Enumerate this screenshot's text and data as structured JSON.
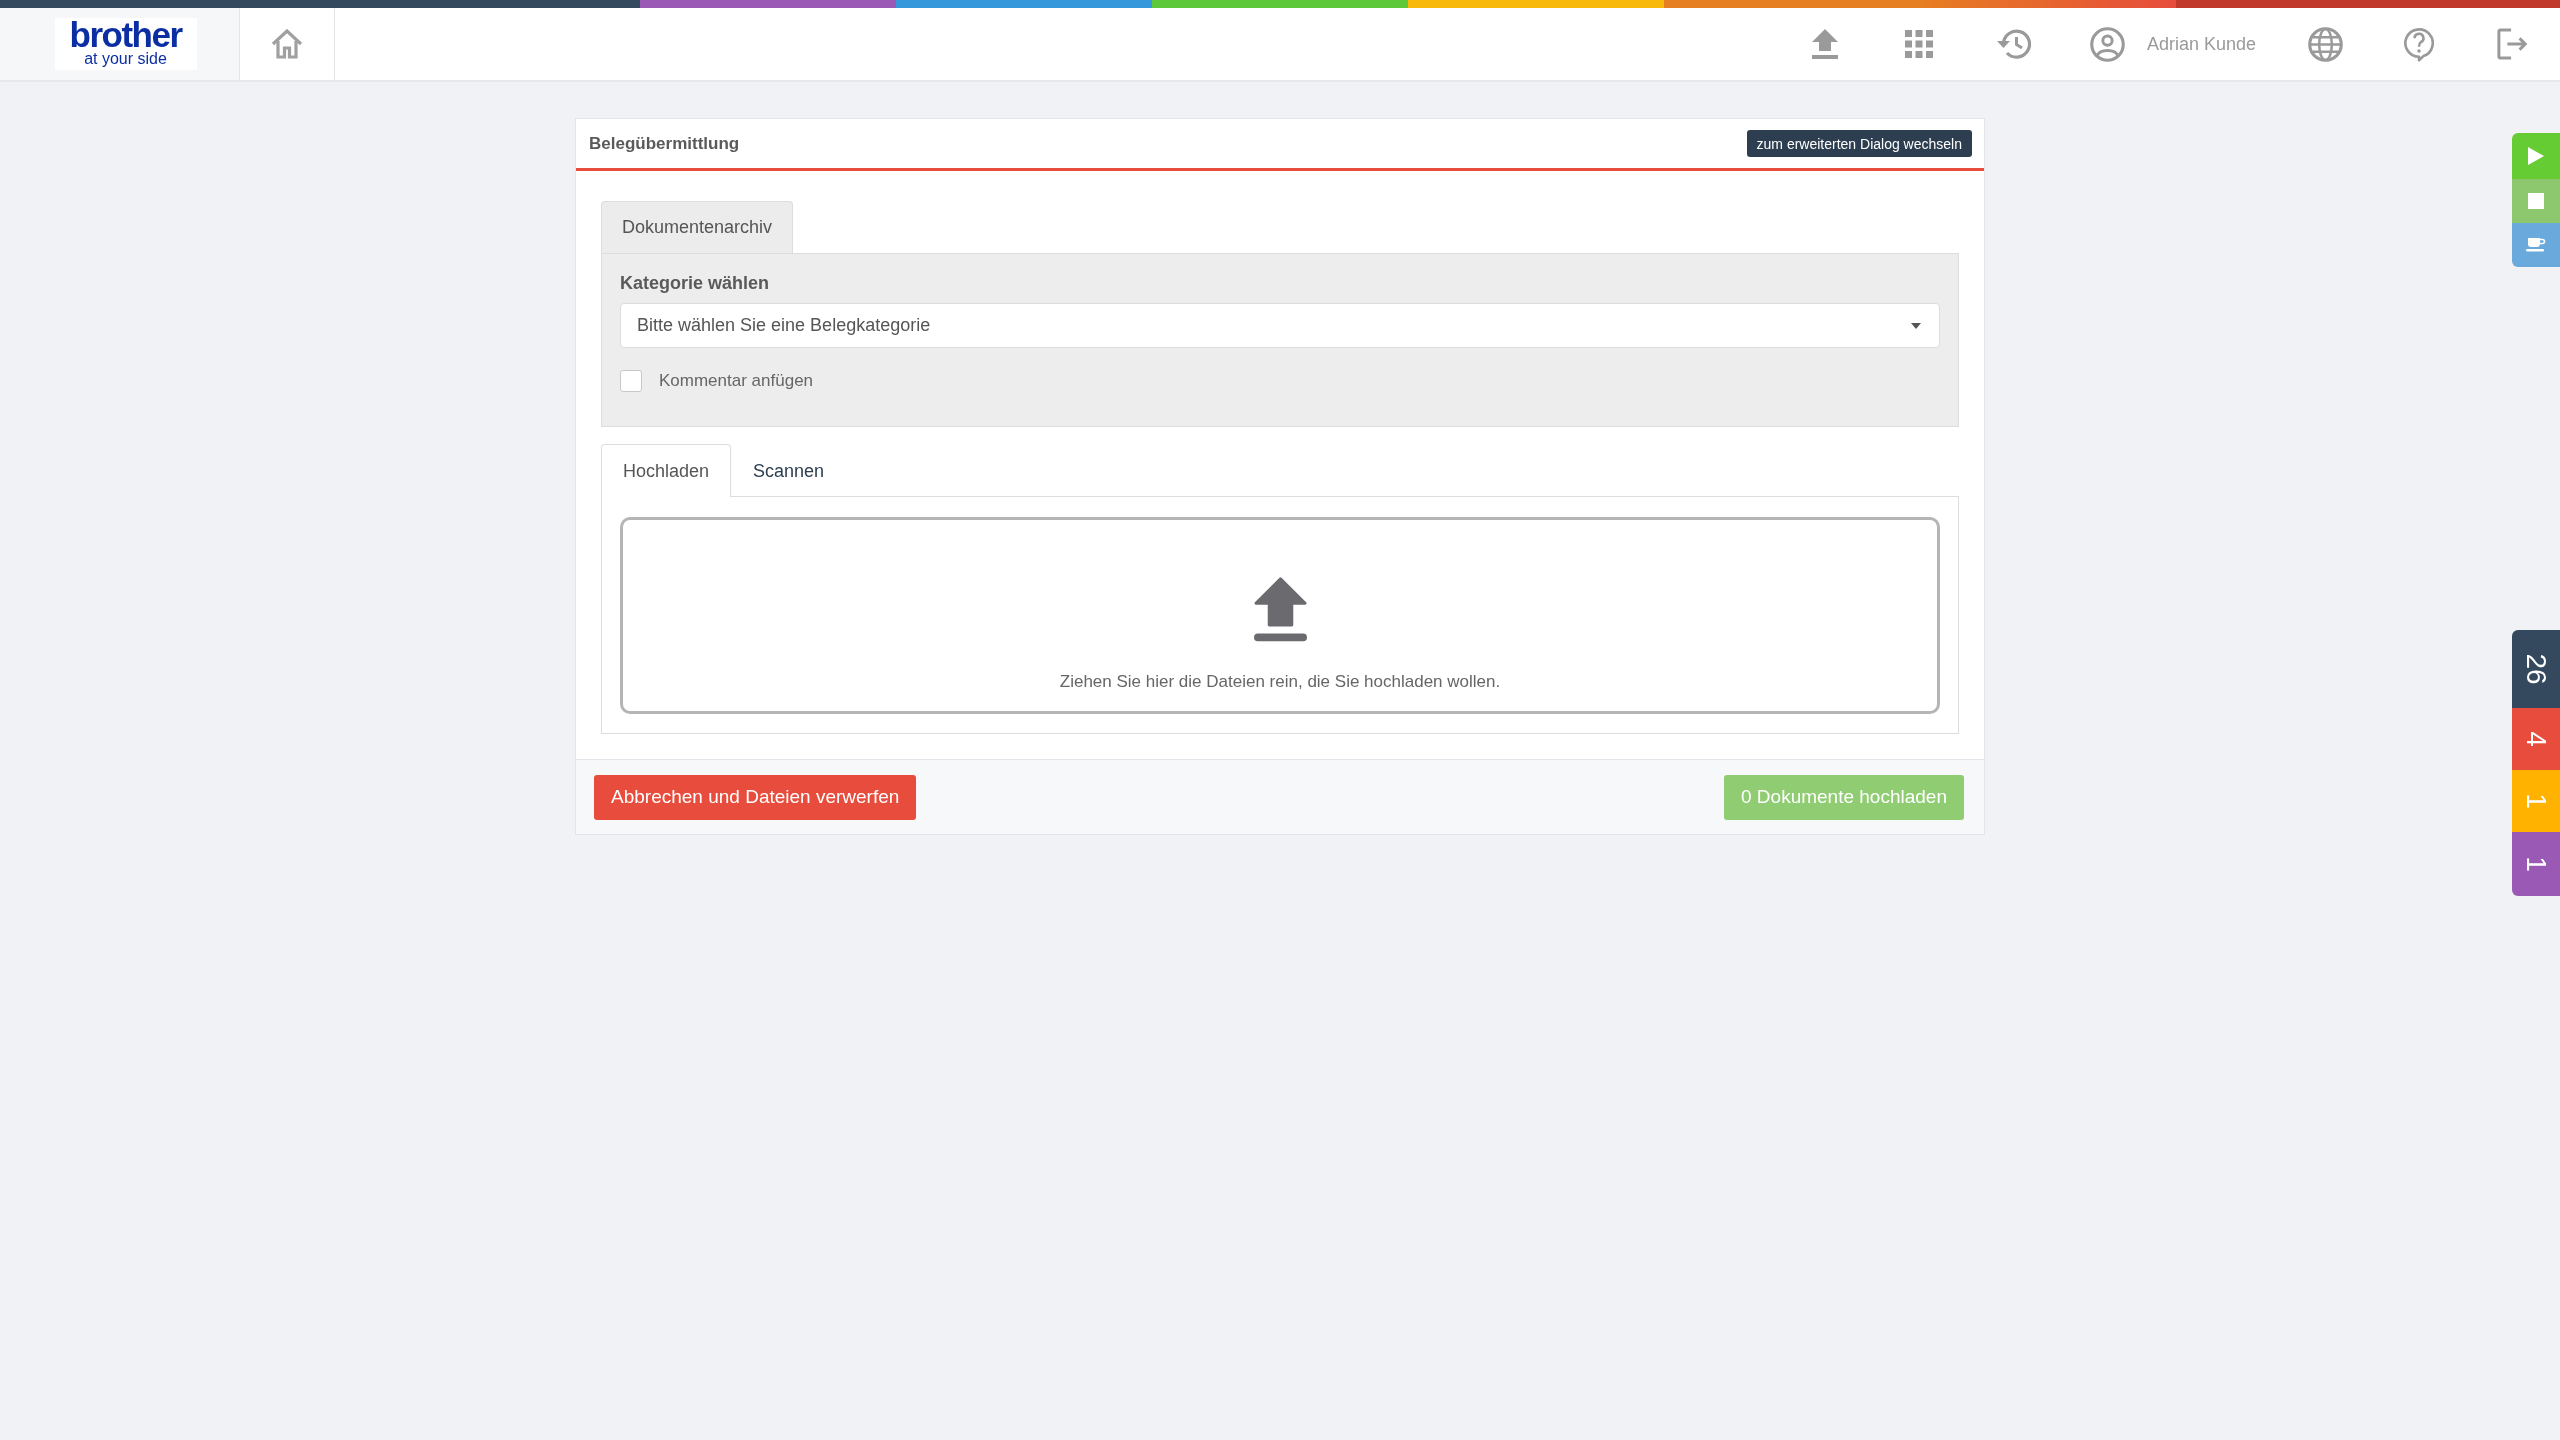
{
  "header": {
    "logo": {
      "wordmark": "brother",
      "tagline": "at your side"
    },
    "user_name": "Adrian Kunde"
  },
  "panel": {
    "title": "Belegübermittlung",
    "switch_button": "zum erweiterten Dialog wechseln",
    "archive_tabs": [
      {
        "label": "Dokumentenarchiv",
        "selected": true
      }
    ],
    "category": {
      "label": "Kategorie wählen",
      "placeholder": "Bitte wählen Sie eine Belegkategorie"
    },
    "comment_option": {
      "label": "Kommentar anfügen",
      "checked": false
    },
    "upload_tabs": [
      {
        "label": "Hochladen",
        "selected": true
      },
      {
        "label": "Scannen",
        "selected": false
      }
    ],
    "drop_zone": {
      "text": "Ziehen Sie hier die Dateien rein, die Sie hochladen wollen."
    },
    "cancel_button": {
      "label": "Abbrechen und Dateien verwerfen"
    },
    "upload_button": {
      "label": "0 Dokumente hochladen",
      "disabled": true
    }
  },
  "timer_controls": [
    {
      "kind": "play",
      "color": "#66cc33"
    },
    {
      "kind": "stop",
      "color": "#8dc86f"
    },
    {
      "kind": "coffee",
      "color": "#69a9dc"
    }
  ],
  "counters": [
    {
      "count": "26",
      "color": "#34495e"
    },
    {
      "count": "4",
      "color": "#e74c3c"
    },
    {
      "count": "1",
      "color": "#ffb300"
    },
    {
      "count": "1",
      "color": "#9b59b6"
    }
  ]
}
